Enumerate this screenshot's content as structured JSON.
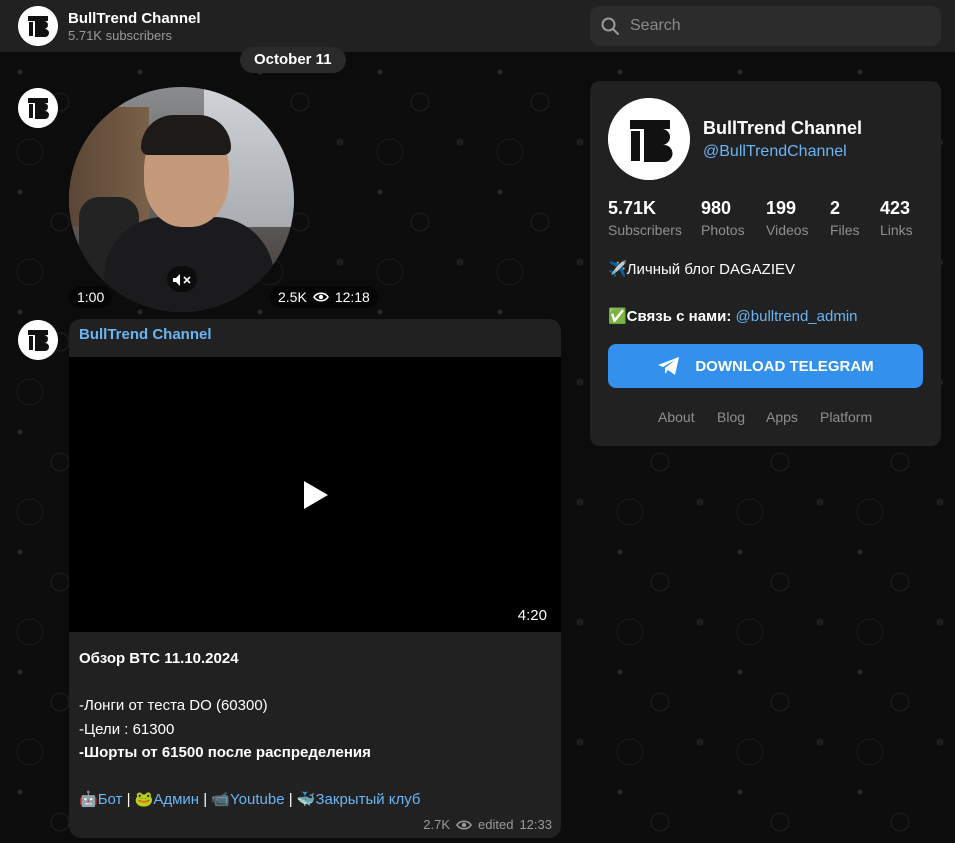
{
  "header": {
    "channel_name": "BullTrend Channel",
    "subscribers": "5.71K subscribers",
    "search_placeholder": "Search"
  },
  "feed": {
    "date_separator": "October 11",
    "round_video": {
      "duration": "1:00",
      "views": "2.5K",
      "time": "12:18"
    },
    "post": {
      "author": "BullTrend Channel",
      "video_duration": "4:20",
      "lines": [
        "Обзор BTC 11.10.2024",
        "",
        "-Лонги от теста DO (60300)",
        "-Цели : 61300",
        "-Шорты от 61500 после распределения",
        ""
      ],
      "links": [
        {
          "emoji": "🤖",
          "label": "Бот"
        },
        {
          "emoji": "🐸",
          "label": "Админ"
        },
        {
          "emoji": "📹",
          "label": "Youtube"
        },
        {
          "emoji": "🐳",
          "label": "Закрытый клуб"
        }
      ],
      "separator": "|",
      "views": "2.7K",
      "edited": "edited",
      "time": "12:33"
    }
  },
  "card": {
    "title": "BullTrend Channel",
    "handle": "@BullTrendChannel",
    "stats": [
      {
        "value": "5.71K",
        "label": "Subscribers"
      },
      {
        "value": "980",
        "label": "Photos"
      },
      {
        "value": "199",
        "label": "Videos"
      },
      {
        "value": "2",
        "label": "Files"
      },
      {
        "value": "423",
        "label": "Links"
      }
    ],
    "bio": "✈️Личный блог DAGAZIEV",
    "contact_prefix": "✅Связь с нами:",
    "contact_handle": "@bulltrend_admin",
    "download_label": "DOWNLOAD TELEGRAM",
    "nav": [
      "About",
      "Blog",
      "Apps",
      "Platform"
    ]
  },
  "colors": {
    "accent": "#3390ec",
    "link": "#69b5f5",
    "panel": "#212121"
  }
}
